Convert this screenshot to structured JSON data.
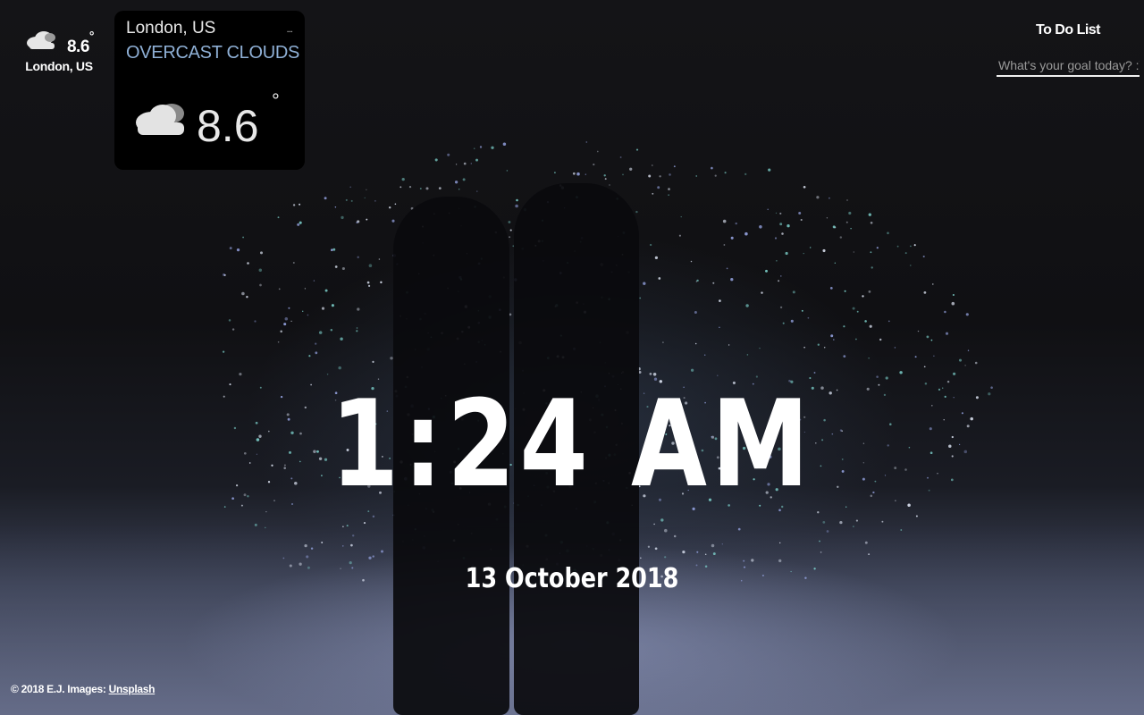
{
  "mini_weather": {
    "icon": "cloud-icon",
    "temp": "8.6",
    "degree_symbol": "°",
    "location": "London, US"
  },
  "weather_card": {
    "location": "London, US",
    "condition": "OVERCAST CLOUDS",
    "more": "...",
    "icon": "cloud-icon",
    "temp": "8.6",
    "degree_symbol": "°"
  },
  "todo": {
    "title": "To Do List",
    "placeholder": "What's your goal today? :)"
  },
  "clock": {
    "time": "1:24 AM",
    "date": "13 October 2018"
  },
  "footer": {
    "text": "© 2018 E.J. Images: ",
    "link": "Unsplash"
  },
  "colors": {
    "condition": "#8fb0d6",
    "card_bg": "#000000"
  }
}
